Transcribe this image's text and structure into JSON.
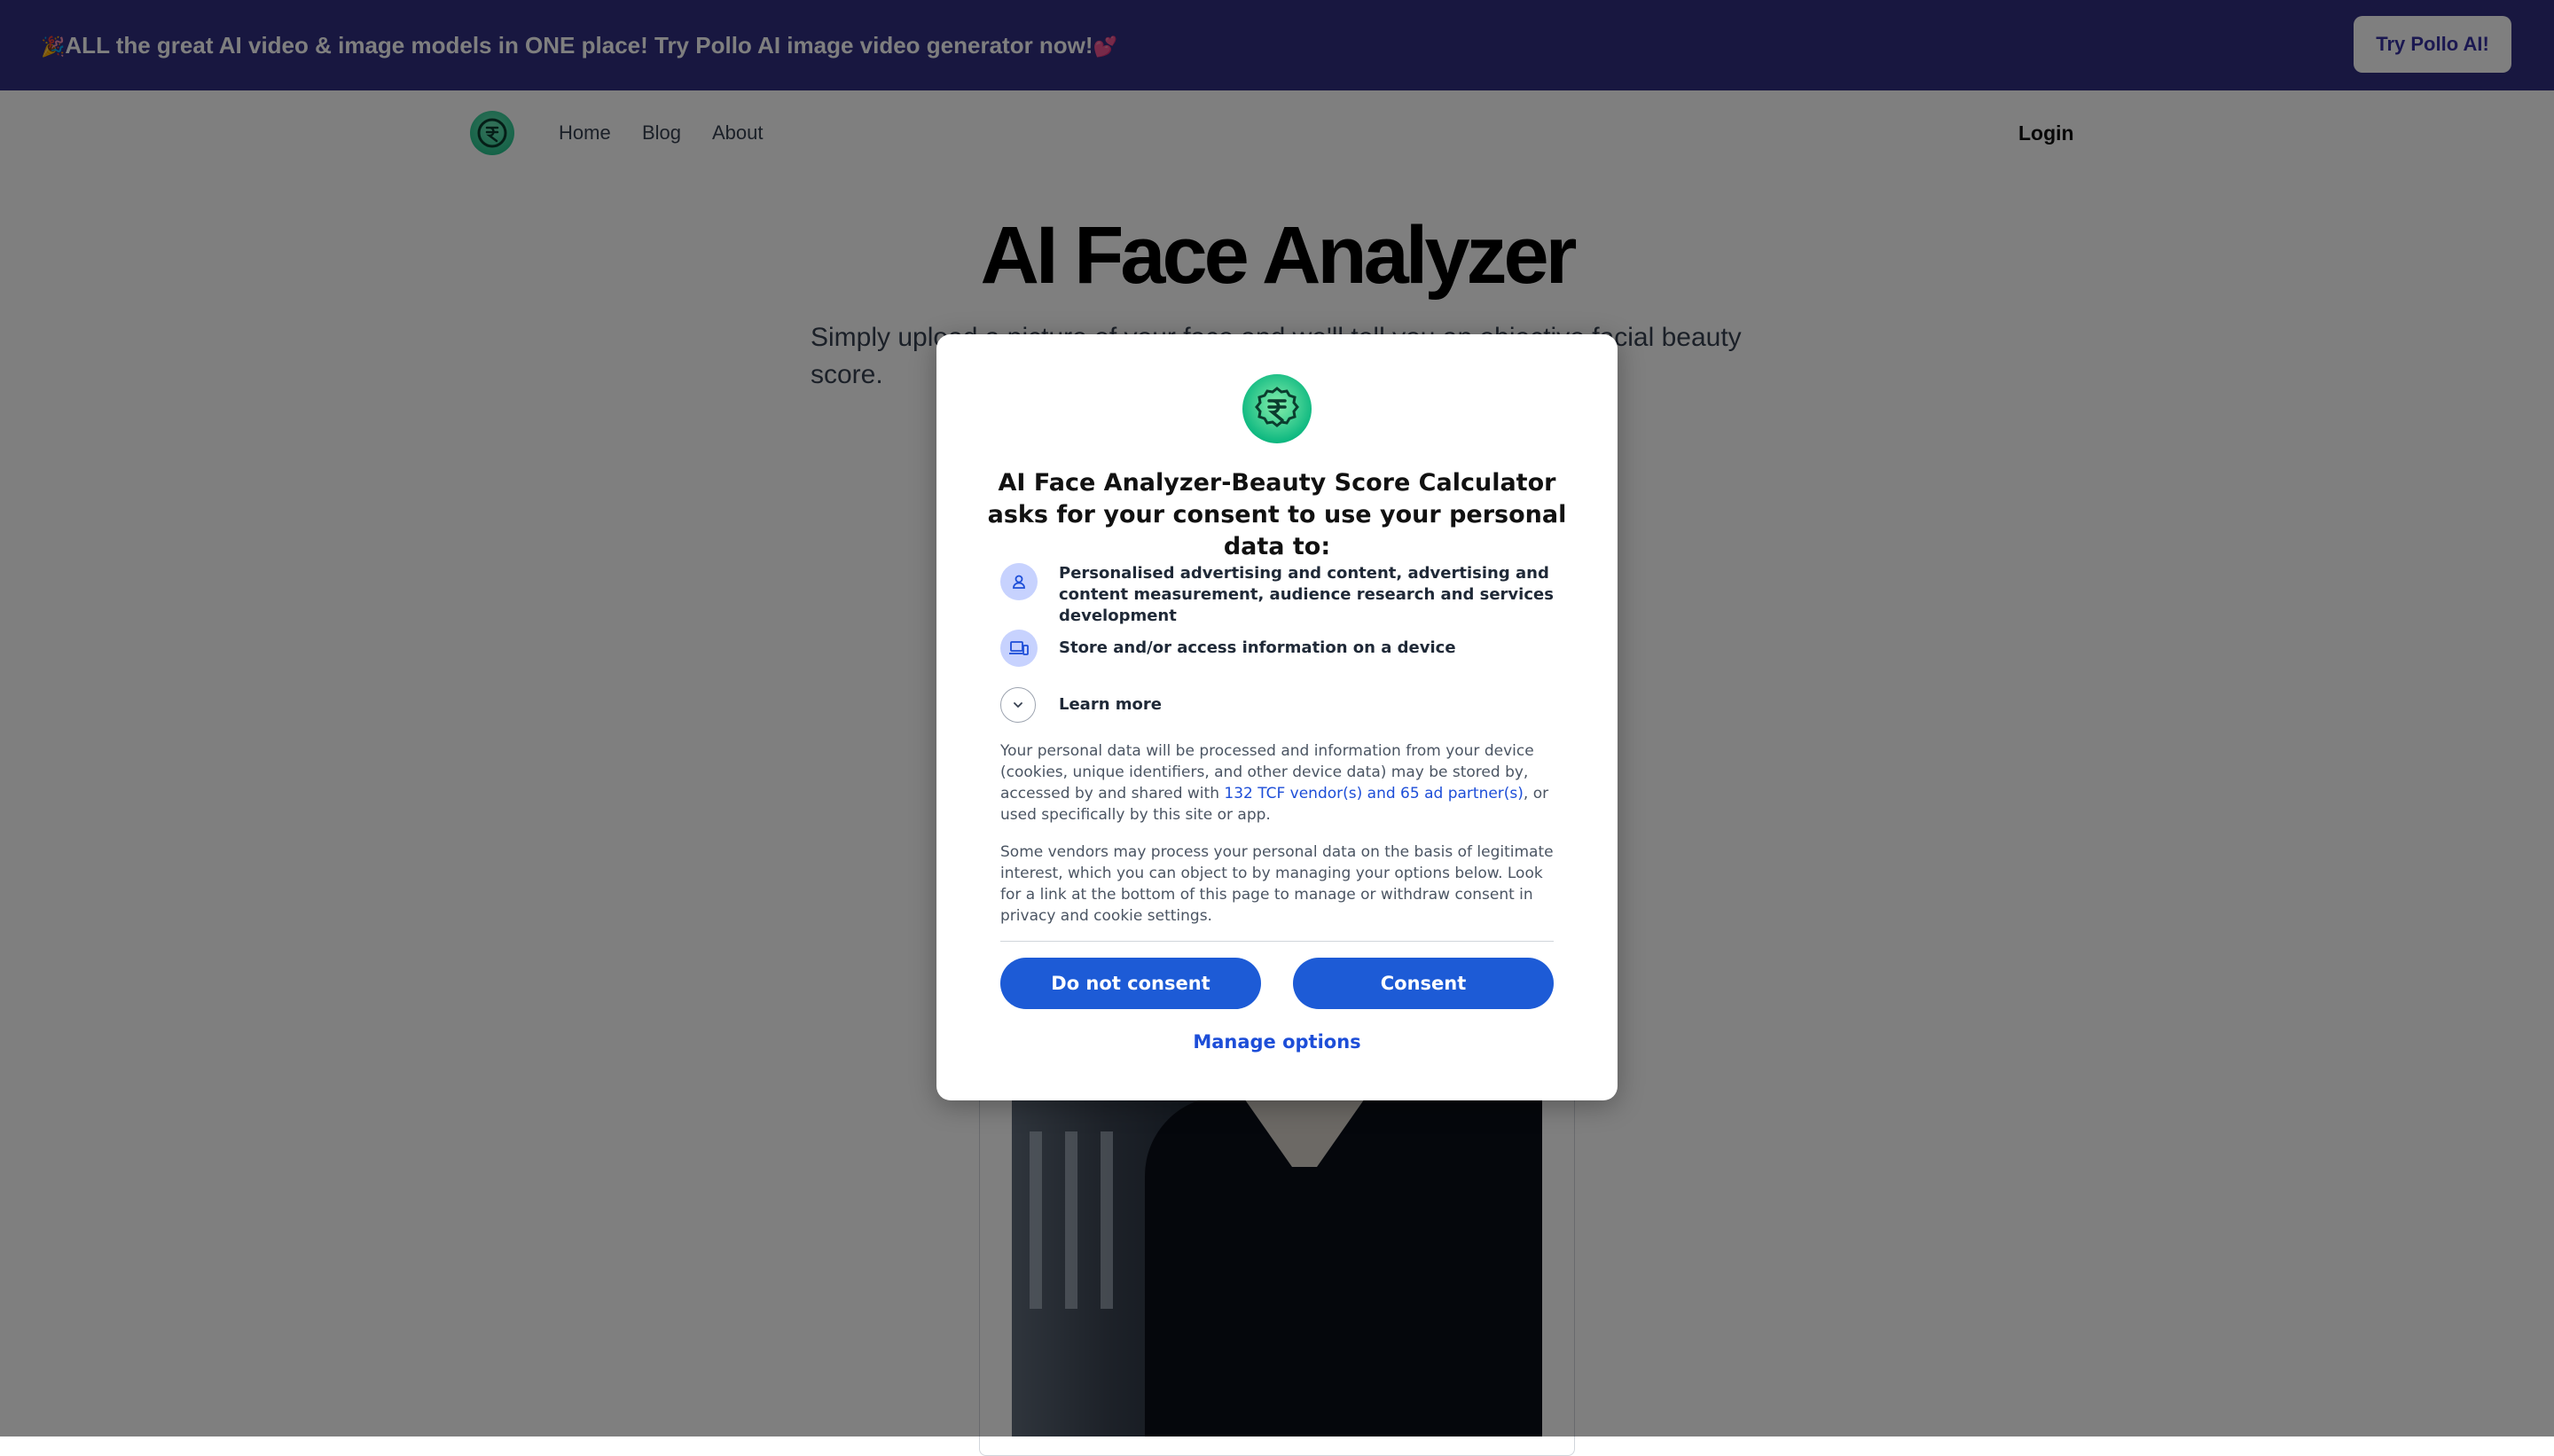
{
  "banner": {
    "emoji_left": "🎉",
    "text": "ALL the great AI video & image models in ONE place! Try Pollo AI image video generator now!",
    "emoji_right": "💕",
    "button_label": "Try Pollo AI!"
  },
  "nav": {
    "logo_icon": "currency-coin-logo",
    "links": [
      "Home",
      "Blog",
      "About"
    ],
    "login_label": "Login"
  },
  "hero": {
    "title": "AI Face Analyzer",
    "subtitle": "Simply upload a picture of your face and we'll tell you an objective facial beauty score."
  },
  "consent": {
    "title": "AI Face Analyzer-Beauty Score Calculator asks for your consent to use your personal data to:",
    "purposes": [
      {
        "icon": "person-icon",
        "text": "Personalised advertising and content, advertising and content measurement, audience research and services development"
      },
      {
        "icon": "devices-icon",
        "text": "Store and/or access information on a device"
      }
    ],
    "learn_more_label": "Learn more",
    "paragraph1_before": "Your personal data will be processed and information from your device (cookies, unique identifiers, and other device data) may be stored by, accessed by and shared with ",
    "paragraph1_link": "132 TCF vendor(s) and 65 ad partner(s)",
    "paragraph1_after": ", or used specifically by this site or app.",
    "paragraph2": "Some vendors may process your personal data on the basis of legitimate interest, which you can object to by managing your options below. Look for a link at the bottom of this page to manage or withdraw consent in privacy and cookie settings.",
    "do_not_consent_label": "Do not consent",
    "consent_label": "Consent",
    "manage_label": "Manage options"
  },
  "colors": {
    "banner_bg": "#312e81",
    "accent_blue": "#1d5bd6",
    "logo_green": "#10b981"
  }
}
